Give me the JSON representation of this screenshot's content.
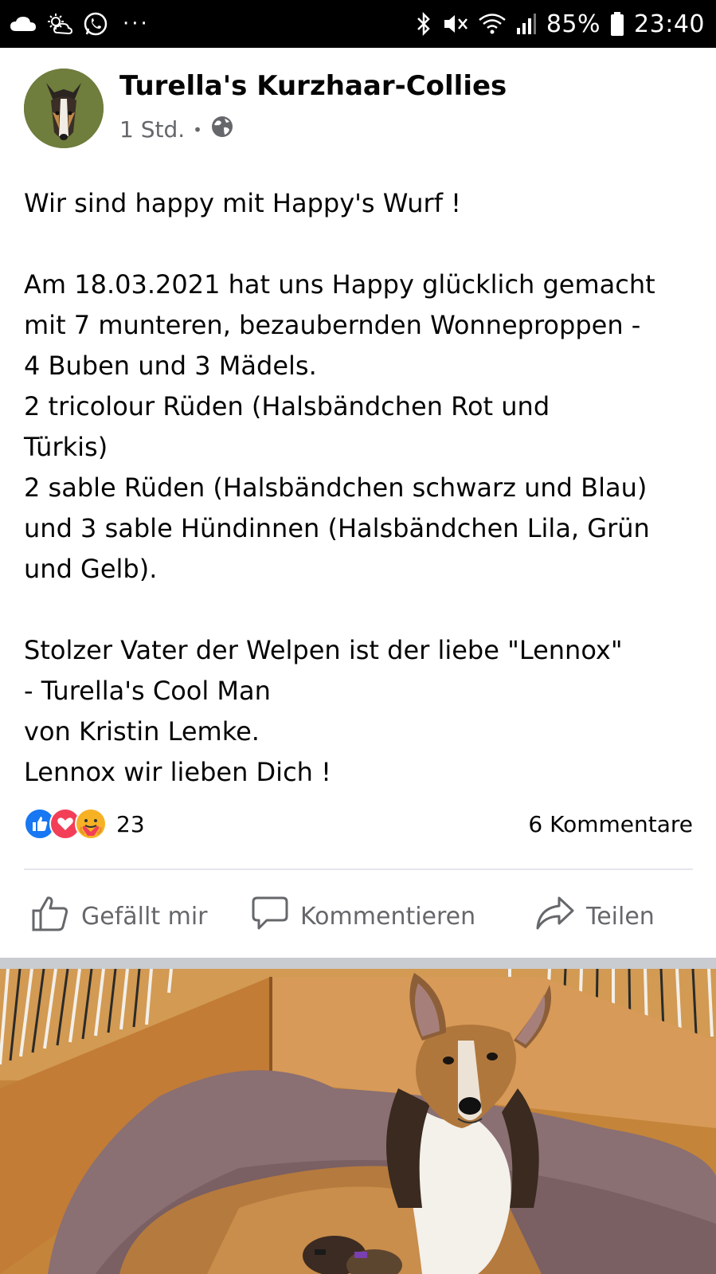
{
  "status_bar": {
    "battery": "85%",
    "time": "23:40",
    "more": "···"
  },
  "post": {
    "page_name": "Turella's Kurzhaar-Collies",
    "time_ago": "1 Std.",
    "separator": "•",
    "lines": [
      "Wir sind happy mit Happy's Wurf !",
      "",
      "Am 18.03.2021 hat uns Happy glücklich gemacht",
      "mit 7 munteren, bezaubernden Wonneproppen -",
      "4 Buben und 3 Mädels.",
      "2 tricolour Rüden (Halsbändchen Rot und",
      "Türkis)",
      "2 sable Rüden (Halsbändchen schwarz und Blau)",
      "und 3 sable Hündinnen (Halsbändchen Lila, Grün",
      "und Gelb).",
      "",
      "Stolzer Vater der Welpen ist der liebe \"Lennox\"",
      "- Turella's Cool Man",
      "von Kristin Lemke.",
      "Lennox wir lieben Dich !"
    ]
  },
  "reactions": {
    "count": "23",
    "comments": "6 Kommentare"
  },
  "actions": {
    "like": "Gefällt mir",
    "comment": "Kommentieren",
    "share": "Teilen"
  },
  "colors": {
    "like_blue": "#1877f2",
    "love_red": "#f33e58",
    "care_yellow": "#f7b125",
    "secondary_text": "#65676b"
  }
}
